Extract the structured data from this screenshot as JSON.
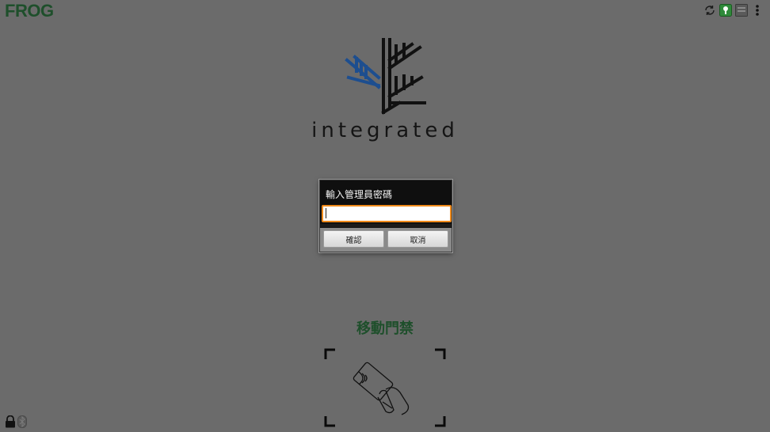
{
  "topbar": {
    "brand": "FROG",
    "icons": [
      "sync-icon",
      "green-key-icon",
      "keyboard-icon",
      "overflow-menu-icon"
    ]
  },
  "logo": {
    "wordmark": "integrated",
    "colors": {
      "blue": "#1d4e8f",
      "black": "#111111"
    }
  },
  "dialog": {
    "title": "輸入管理員密碼",
    "input_value": "",
    "confirm_label": "確認",
    "cancel_label": "取消",
    "focus_color": "#f08a1a"
  },
  "access": {
    "title": "移動門禁",
    "icon": "nfc-card-hand-icon"
  },
  "footer": {
    "icons": [
      "lock-icon",
      "bluetooth-icon"
    ]
  },
  "colors": {
    "background": "#6b6b6b",
    "brand_green": "#1e4f2b"
  }
}
